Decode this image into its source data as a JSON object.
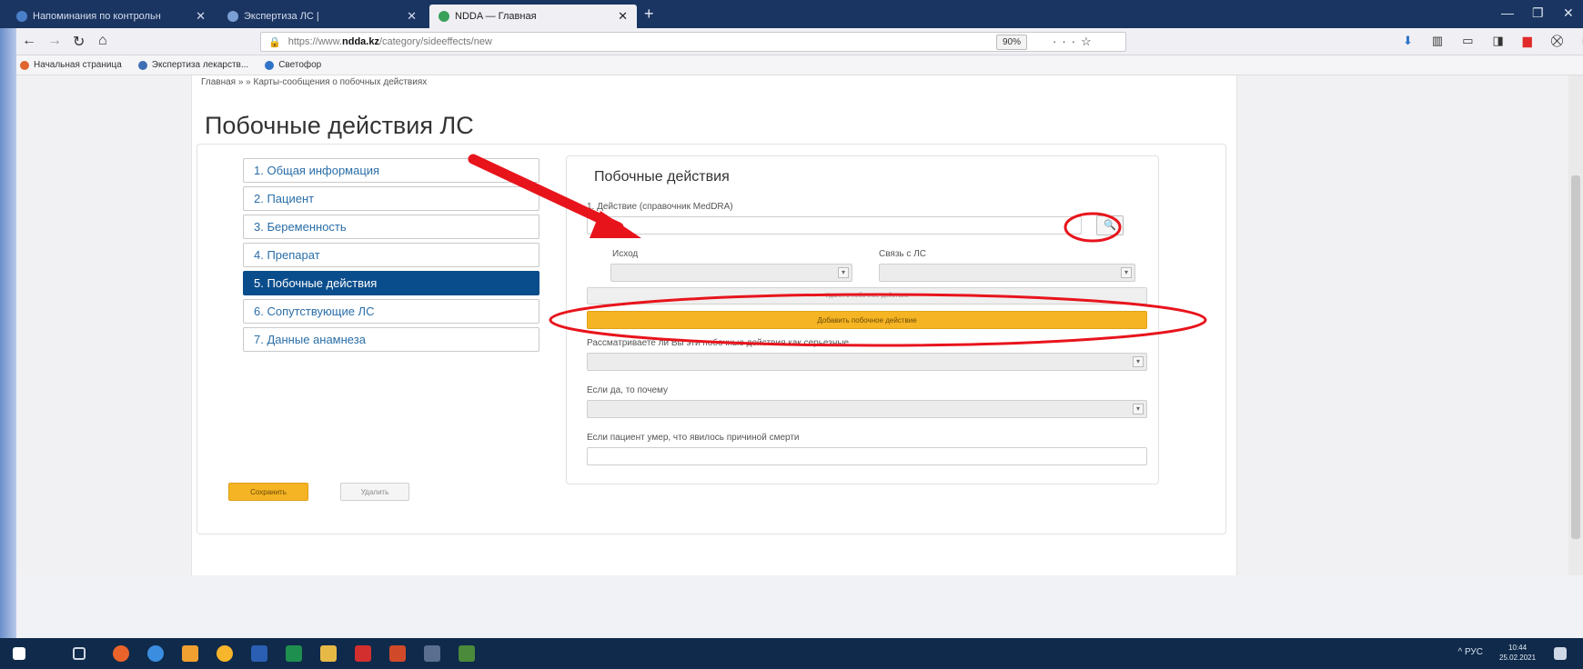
{
  "browser": {
    "tabs": [
      {
        "title": "Напоминания по контрольн",
        "color": "#4a7fc9"
      },
      {
        "title": "Экспертиза ЛС |",
        "color": "#7aa0d6"
      },
      {
        "title": "NDDA — Главная",
        "color": "#3aa15b"
      }
    ],
    "url_prefix": "https://www.",
    "url_host": "ndda.kz",
    "url_path": "/category/sideeffects/new",
    "zoom": "90%",
    "bookmarks": [
      {
        "label": "Начальная страница",
        "color": "#e0662e"
      },
      {
        "label": "Экспертиза лекарств...",
        "color": "#3e6fb3"
      },
      {
        "label": "Светофор",
        "color": "#2f73c9"
      }
    ]
  },
  "page": {
    "breadcrumb": "Главная » » Карты-сообщения о побочных действиях",
    "title": "Побочные действия ЛС",
    "steps": [
      "1. Общая информация",
      "2. Пациент",
      "3. Беременность",
      "4. Препарат",
      "5. Побочные действия",
      "6. Сопутствующие ЛС",
      "7. Данные анамнеза"
    ],
    "panel": {
      "title": "Побочные действия",
      "action_label": "1. Действие (справочник MedDRA)",
      "outcome_label": "Исход",
      "relation_label": "Связь с ЛС",
      "remove_button": "Удалить побочное действие",
      "add_button": "Добавить побочное действие",
      "serious_label": "Рассматриваете ли Вы эти побочные действия как серьезные",
      "why_label": "Если да, то почему",
      "death_label": "Если пациент умер, что явилось причиной смерти"
    },
    "save_button": "Сохранить",
    "cancel_button": "Удалить"
  },
  "taskbar": {
    "tray": "^ РУС",
    "time": "10:44",
    "date": "25.02.2021"
  },
  "colors": {
    "accent_active": "#0a4d8c",
    "button_orange": "#f5b423",
    "annotation_red": "#e8141c"
  }
}
